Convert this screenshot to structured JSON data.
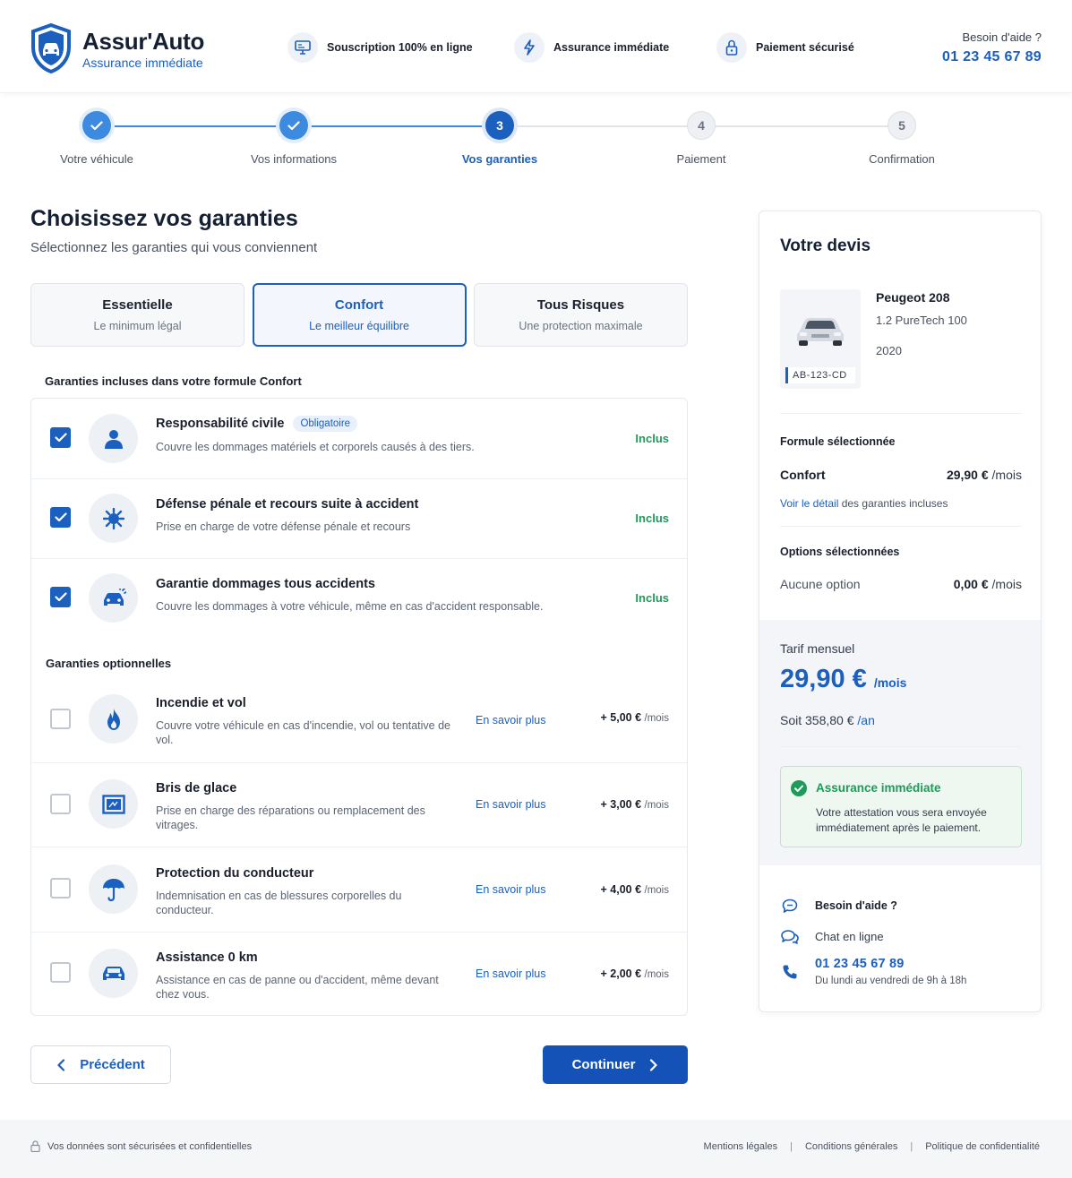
{
  "header": {
    "brand_name": "Assur'Auto",
    "brand_tagline": "Assurance immédiate",
    "features": [
      {
        "label": "Souscription 100% en ligne",
        "icon": "monitor-icon"
      },
      {
        "label": "Assurance immédiate",
        "icon": "lightning-icon"
      },
      {
        "label": "Paiement sécurisé",
        "icon": "lock-icon"
      }
    ],
    "help_label": "Besoin d'aide ?",
    "help_phone": "01 23 45 67 89"
  },
  "stepper": {
    "steps": [
      {
        "number": "1",
        "label": "Votre véhicule",
        "state": "done"
      },
      {
        "number": "2",
        "label": "Vos informations",
        "state": "done"
      },
      {
        "number": "3",
        "label": "Vos garanties",
        "state": "active"
      },
      {
        "number": "4",
        "label": "Paiement",
        "state": "todo"
      },
      {
        "number": "5",
        "label": "Confirmation",
        "state": "todo"
      }
    ]
  },
  "main": {
    "title": "Choisissez vos garanties",
    "subtitle": "Sélectionnez les garanties qui vous conviennent",
    "formulas": [
      {
        "name": "Essentielle",
        "desc": "Le minimum légal",
        "selected": false
      },
      {
        "name": "Confort",
        "desc": "Le meilleur équilibre",
        "selected": true
      },
      {
        "name": "Tous Risques",
        "desc": "Une protection maximale",
        "selected": false
      }
    ],
    "included_title": "Garanties incluses dans votre formule Confort",
    "included": [
      {
        "title": "Responsabilité civile",
        "badge": "Obligatoire",
        "desc": "Couvre les dommages matériels et corporels causés à des tiers.",
        "status": "Inclus",
        "icon": "person-icon"
      },
      {
        "title": "Défense pénale et recours suite à accident",
        "badge": "",
        "desc": "Prise en charge de votre défense pénale et recours",
        "status": "Inclus",
        "icon": "gavel-icon"
      },
      {
        "title": "Garantie dommages tous accidents",
        "badge": "",
        "desc": "Couvre les dommages à votre véhicule, même en cas d'accident responsable.",
        "status": "Inclus",
        "icon": "car-crash-icon"
      }
    ],
    "optional_title": "Garanties optionnelles",
    "optional": [
      {
        "title": "Incendie et vol",
        "desc": "Couvre votre véhicule en cas d'incendie, vol ou tentative de vol.",
        "more": "En savoir plus",
        "price": "+ 5,00 €",
        "unit": "/mois",
        "icon": "fire-icon"
      },
      {
        "title": "Bris de glace",
        "desc": "Prise en charge des réparations ou remplacement des vitrages.",
        "more": "En savoir plus",
        "price": "+ 3,00 €",
        "unit": "/mois",
        "icon": "glass-icon"
      },
      {
        "title": "Protection du conducteur",
        "desc": "Indemnisation en cas de blessures corporelles du conducteur.",
        "more": "En savoir plus",
        "price": "+ 4,00 €",
        "unit": "/mois",
        "icon": "umbrella-icon"
      },
      {
        "title": "Assistance 0 km",
        "desc": "Assistance en cas de panne ou d'accident, même devant chez vous.",
        "more": "En savoir plus",
        "price": "+ 2,00 €",
        "unit": "/mois",
        "icon": "car-icon"
      }
    ],
    "btn_prev": "Précédent",
    "btn_next": "Continuer"
  },
  "quote": {
    "title": "Votre devis",
    "car_model": "Peugeot 208",
    "car_engine": "1.2 PureTech 100",
    "car_year": "2020",
    "plate": "AB-123-CD",
    "formula_label": "Formule sélectionnée",
    "formula_name": "Confort",
    "formula_price": "29,90 €",
    "formula_unit": "/mois",
    "detail_link": "Voir le détail",
    "detail_rest": " des garanties incluses",
    "options_label": "Options sélectionnées",
    "options_none": "Aucune option",
    "options_price": "0,00 €",
    "options_unit": "/mois",
    "tarif_label": "Tarif mensuel",
    "tarif_price": "29,90 €",
    "tarif_unit": "/mois",
    "tarif_year_prefix": "Soit 358,80 € ",
    "tarif_year_unit": "/an",
    "imm_title": "Assurance immédiate",
    "imm_desc": "Votre attestation vous sera envoyée immédiatement après le paiement.",
    "support_title": "Besoin d'aide ?",
    "support_chat": "Chat en ligne",
    "support_phone": "01 23 45 67 89",
    "support_hours": "Du lundi au vendredi de 9h à 18h"
  },
  "footer": {
    "security": "Vos données sont sécurisées et confidentielles",
    "links": [
      "Mentions légales",
      "Conditions générales",
      "Politique de confidentialité"
    ]
  },
  "colors": {
    "primary": "#1b5fbf",
    "success": "#1e9a5a",
    "button": "#1552b8"
  }
}
